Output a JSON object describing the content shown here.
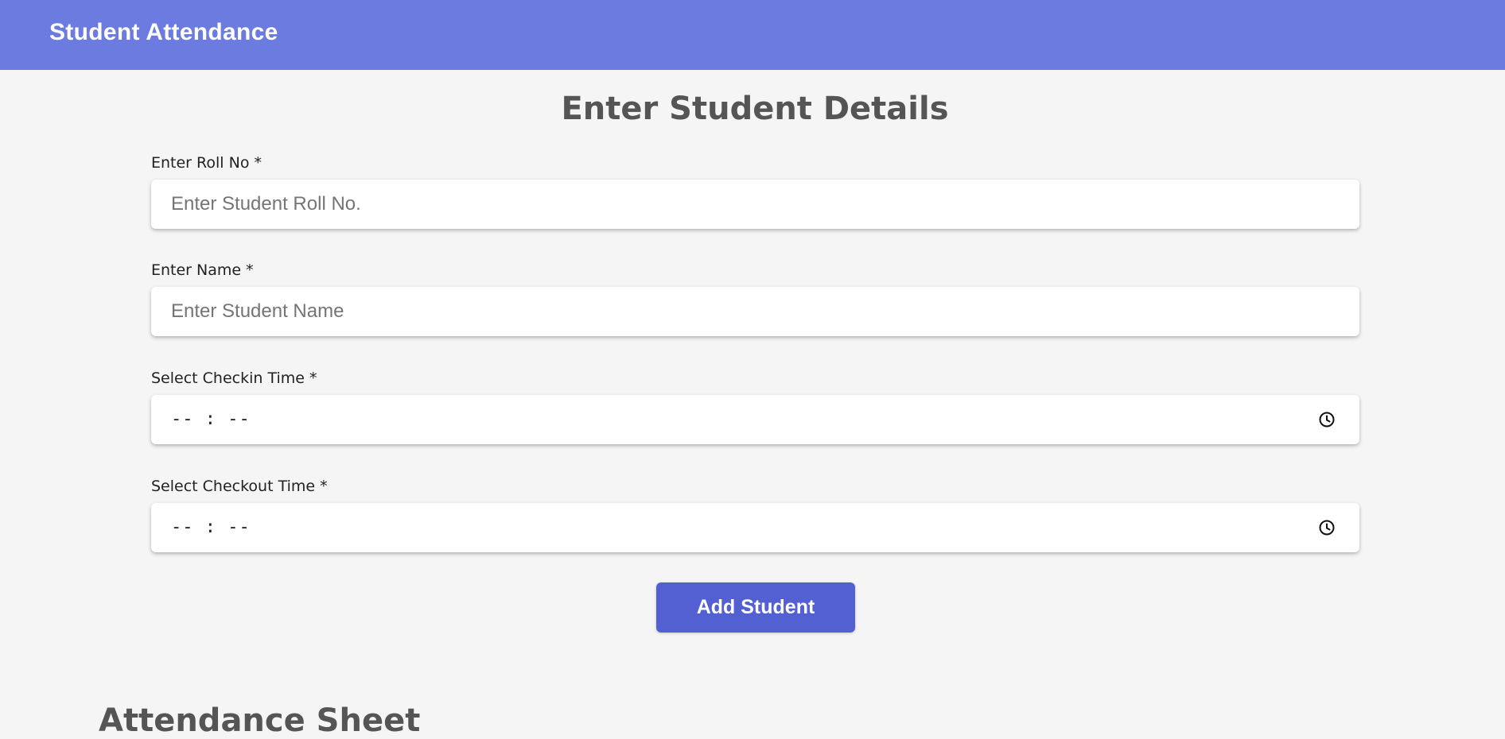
{
  "navbar": {
    "brand": "Student Attendance"
  },
  "form": {
    "title": "Enter Student Details",
    "fields": [
      {
        "label": "Enter Roll No *",
        "placeholder": "Enter Student Roll No."
      },
      {
        "label": "Enter Name *",
        "placeholder": "Enter Student Name"
      },
      {
        "label": "Select Checkin Time *",
        "value": "-- : --",
        "icon": "clock-icon"
      },
      {
        "label": "Select Checkout Time *",
        "value": "-- : --",
        "icon": "clock-icon"
      }
    ],
    "submit_label": "Add Student"
  },
  "sheet": {
    "title": "Attendance Sheet"
  },
  "colors": {
    "navbar": "#6c7be0",
    "button": "#5360d2",
    "background": "#f5f5f5"
  }
}
